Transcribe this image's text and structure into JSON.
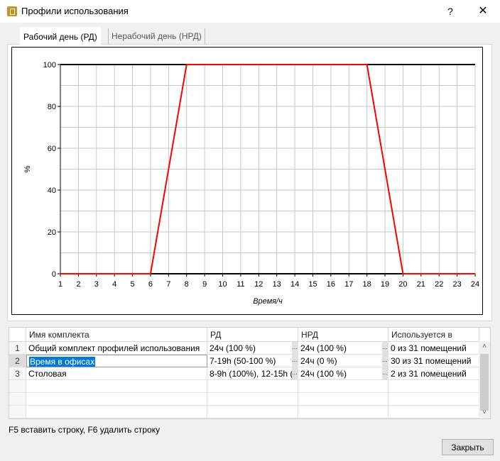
{
  "window": {
    "title": "Профили использования",
    "help": "?",
    "close": "✕"
  },
  "tabs": [
    {
      "label": "Рабочий день (РД)",
      "active": true
    },
    {
      "label": "Нерабочий день (НРД)",
      "active": false
    }
  ],
  "chart_data": {
    "type": "line",
    "xlabel": "Время/ч",
    "ylabel": "%",
    "xlim": [
      1,
      24
    ],
    "ylim": [
      0,
      100
    ],
    "xticks": [
      1,
      2,
      3,
      4,
      5,
      6,
      7,
      8,
      9,
      10,
      11,
      12,
      13,
      14,
      15,
      16,
      17,
      18,
      19,
      20,
      21,
      22,
      23,
      24
    ],
    "yticks": [
      0,
      20,
      40,
      60,
      80,
      100
    ],
    "grid": true,
    "series": [
      {
        "color": "#ff0000",
        "x": [
          1,
          6,
          8,
          18,
          20,
          24
        ],
        "y": [
          0,
          0,
          100,
          100,
          0,
          0
        ]
      }
    ],
    "baseline_color": "#000000"
  },
  "table": {
    "columns": [
      "Имя комплекта",
      "РД",
      "НРД",
      "Используется в"
    ],
    "rows": [
      {
        "num": "1",
        "name": "Общий комплект профилей использования",
        "rd": "24ч (100 %)",
        "nrd": "24ч (100 %)",
        "used": "0 из 31 помещений"
      },
      {
        "num": "2",
        "name": "Время в офисах",
        "rd": "7-19h (50-100 %)",
        "nrd": "24ч (0 %)",
        "used": "30 из 31 помещений"
      },
      {
        "num": "3",
        "name": "Столовая",
        "rd": "8-9h (100%), 12-15h (1...",
        "nrd": "24ч (100 %)",
        "used": "2 из 31 помещений"
      }
    ],
    "ellipsis": "..."
  },
  "hint": "F5 вставить строку, F6 удалить строку",
  "close_button": "Закрыть",
  "colors": {
    "accent": "#0078d7",
    "series": "#ff0000"
  }
}
